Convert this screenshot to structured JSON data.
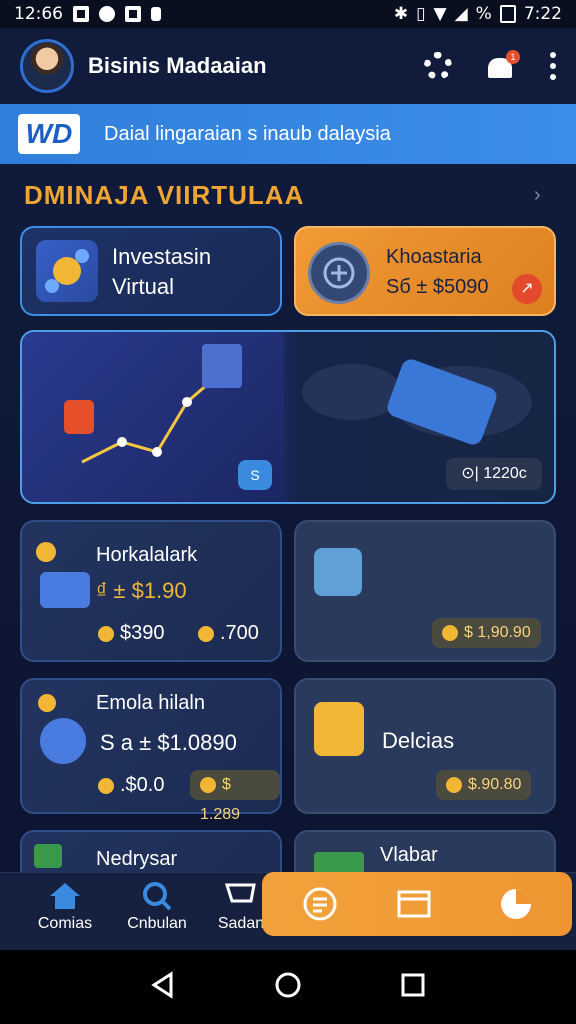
{
  "status_bar": {
    "time_left": "12:66",
    "battery": "%",
    "time_right": "7:22"
  },
  "header": {
    "title": "Bisinis Madaaian",
    "notification_count": "1"
  },
  "banner": {
    "logo": "WD",
    "text": "Daial lingaraian s inaub dalaysia"
  },
  "section": {
    "title": "DMINAJA VIIRTULAA"
  },
  "cards": {
    "invest": {
      "line1": "Investasin",
      "line2": "Virtual"
    },
    "orange": {
      "title": "Khoastaria",
      "value": "Sб ± $5090",
      "badge": "↗"
    },
    "hero": {
      "badge": "S",
      "chip": "⊙| 1220c"
    },
    "hork": {
      "title": "Horkalalark",
      "value": "₫ ± $1.90",
      "stat1": "$390",
      "stat2": ".700"
    },
    "tool": {
      "chip": "$ 1,90.90"
    },
    "emola": {
      "title": "Emola hilaln",
      "value": "S a ± $1.0890",
      "stat1": ".$0.0",
      "chip": "$ 1.289"
    },
    "delcias": {
      "title": "Delcias",
      "chip": "$.90.80"
    },
    "nedrysar": {
      "title": "Nedrysar"
    },
    "vlabar": {
      "title": "Vlabar"
    }
  },
  "nav": {
    "items": [
      {
        "label": "Comias"
      },
      {
        "label": "Cnbulan"
      },
      {
        "label": "Sadan"
      }
    ]
  },
  "colors": {
    "accent": "#3e8ee6",
    "orange": "#f09a35",
    "bg": "#0e1836"
  }
}
